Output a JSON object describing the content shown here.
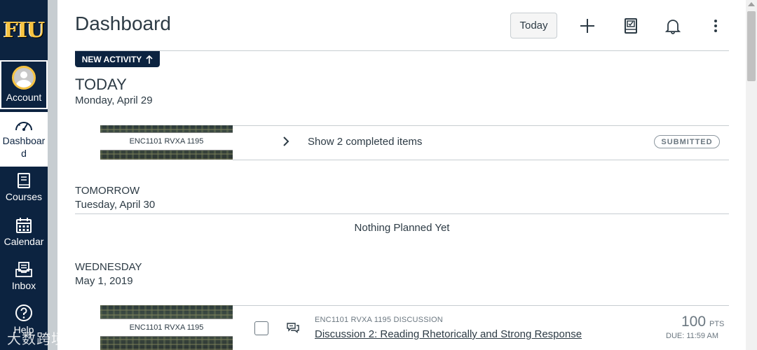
{
  "nav": {
    "logo": "FIU",
    "account_label": "Account",
    "dashboard_label": "Dashboar\nd",
    "courses_label": "Courses",
    "calendar_label": "Calendar",
    "inbox_label": "Inbox",
    "help_label": "Help"
  },
  "header": {
    "title": "Dashboard",
    "today_button": "Today",
    "icons": [
      "plus-icon",
      "todo-list-icon",
      "bell-icon",
      "more-vertical-icon"
    ]
  },
  "new_activity": {
    "label": "NEW ACTIVITY"
  },
  "days": {
    "today": {
      "label": "TODAY",
      "date": "Monday, April 29",
      "course": "ENC1101 RVXA 1195",
      "completed_link": "Show 2 completed items",
      "status": "SUBMITTED"
    },
    "tomorrow": {
      "label": "TOMORROW",
      "date": "Tuesday, April 30",
      "empty": "Nothing Planned Yet"
    },
    "wednesday": {
      "label": "WEDNESDAY",
      "date": "May 1, 2019",
      "course": "ENC1101 RVXA 1195",
      "item": {
        "context": "ENC1101 RVXA 1195 DISCUSSION",
        "title": "Discussion 2: Reading Rhetorically and Strong Response",
        "points": "100",
        "points_unit": "PTS",
        "due": "DUE: 11:59 AM"
      }
    }
  },
  "watermark": "大数跨境",
  "colors": {
    "nav_bg": "#0c2340",
    "accent_gold": "#f6c342",
    "text": "#2d3b45",
    "muted": "#6b7780"
  }
}
